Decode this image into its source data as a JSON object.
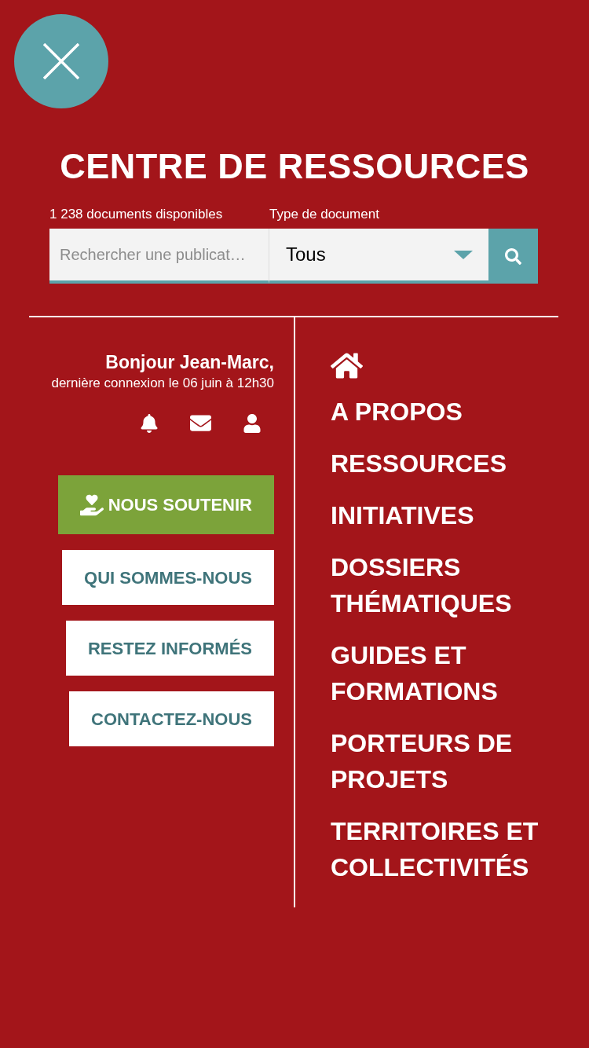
{
  "header": {
    "title": "CENTRE DE RESSOURCES",
    "document_count": "1 238 documents disponibles",
    "type_label": "Type de document"
  },
  "search": {
    "placeholder": "Rechercher une publicat…",
    "document_type": "Tous"
  },
  "account": {
    "greeting": "Bonjour Jean-Marc,",
    "last_login": "dernière connexion le 06 juin à 12h30"
  },
  "buttons": [
    {
      "label": "NOUS SOUTENIR",
      "kind": "primary"
    },
    {
      "label": "QUI SOMMES-NOUS",
      "kind": "secondary"
    },
    {
      "label": "RESTEZ INFORMÉS",
      "kind": "secondary"
    },
    {
      "label": "CONTACTEZ-NOUS",
      "kind": "secondary"
    }
  ],
  "nav": {
    "items": [
      "A PROPOS",
      "RESSOURCES",
      "INITIATIVES",
      "DOSSIERS THÉMATIQUES",
      "GUIDES ET FORMATIONS",
      "PORTEURS DE PROJETS",
      "TERRITOIRES ET COLLECTIVITÉS"
    ]
  }
}
